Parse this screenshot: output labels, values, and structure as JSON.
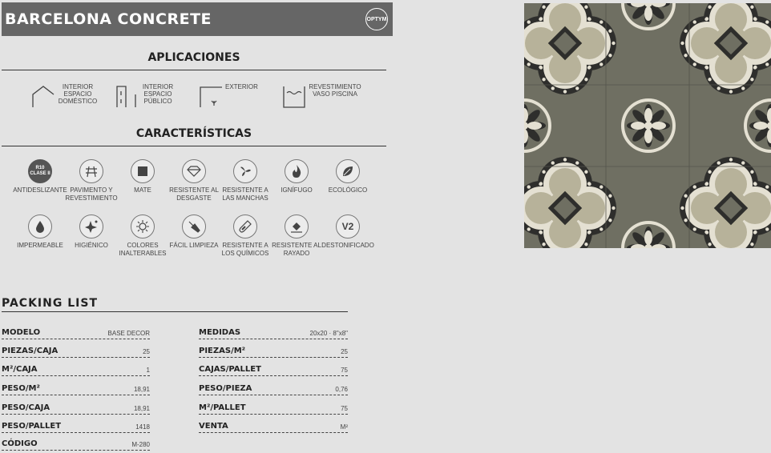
{
  "title": "BARCELONA CONCRETE",
  "brand": "OPTYM",
  "sections": {
    "applications": "APLICACIONES",
    "features": "CARACTERÍSTICAS",
    "packing": "PACKING LIST"
  },
  "applications": [
    {
      "icon": "house-icon",
      "label": "INTERIOR ESPACIO DOMÉSTICO"
    },
    {
      "icon": "building-icon",
      "label": "INTERIOR ESPACIO PÚBLICO"
    },
    {
      "icon": "exterior-icon",
      "label": "EXTERIOR"
    },
    {
      "icon": "pool-icon",
      "label": "REVESTIMIENTO VASO PISCINA"
    }
  ],
  "features": [
    {
      "icon": "r10-icon",
      "label": "ANTIDESLIZANTE",
      "badge": "R10 CLASE II"
    },
    {
      "icon": "grid-icon",
      "label": "PAVIMENTO Y REVESTIMIENTO"
    },
    {
      "icon": "square-icon",
      "label": "MATE"
    },
    {
      "icon": "diamond-icon",
      "label": "RESISTENTE AL DESGASTE"
    },
    {
      "icon": "splash-icon",
      "label": "RESISTENTE A LAS MANCHAS"
    },
    {
      "icon": "flame-icon",
      "label": "IGNÍFUGO"
    },
    {
      "icon": "leaf-icon",
      "label": "ECOLÓGICO"
    },
    {
      "icon": "drop-icon",
      "label": "IMPERMEABLE"
    },
    {
      "icon": "sparkle-icon",
      "label": "HIGIÉNICO"
    },
    {
      "icon": "sun-icon",
      "label": "COLORES INALTERABLES"
    },
    {
      "icon": "brush-icon",
      "label": "FÁCIL LIMPIEZA"
    },
    {
      "icon": "flask-icon",
      "label": "RESISTENTE A LOS QUÍMICOS"
    },
    {
      "icon": "scratch-icon",
      "label": "RESISTENTE AL RAYADO"
    },
    {
      "icon": "v2-icon",
      "label": "DESTONIFICADO",
      "badge": "V2"
    }
  ],
  "packing_left": [
    {
      "k": "MODELO",
      "v": "BASE DECOR"
    },
    {
      "k": "PIEZAS/CAJA",
      "v": "25"
    },
    {
      "k": "M²/CAJA",
      "v": "1"
    },
    {
      "k": "PESO/M²",
      "v": "18,91"
    },
    {
      "k": "PESO/CAJA",
      "v": "18,91"
    },
    {
      "k": "PESO/PALLET",
      "v": "1418"
    },
    {
      "k": "CÓDIGO",
      "v": "M-280"
    }
  ],
  "packing_right": [
    {
      "k": "MEDIDAS",
      "v": "20x20 · 8\"x8\""
    },
    {
      "k": "PIEZAS/M²",
      "v": "25"
    },
    {
      "k": "CAJAS/PALLET",
      "v": "75"
    },
    {
      "k": "PESO/PIEZA",
      "v": "0,76"
    },
    {
      "k": "M²/PALLET",
      "v": "75"
    },
    {
      "k": "VENTA",
      "v": "M²"
    }
  ],
  "colors": {
    "dark": "#2e2e2c",
    "olive": "#6f6f62",
    "sand": "#b7b29a",
    "cream": "#e4e0d2",
    "header": "#666666"
  }
}
